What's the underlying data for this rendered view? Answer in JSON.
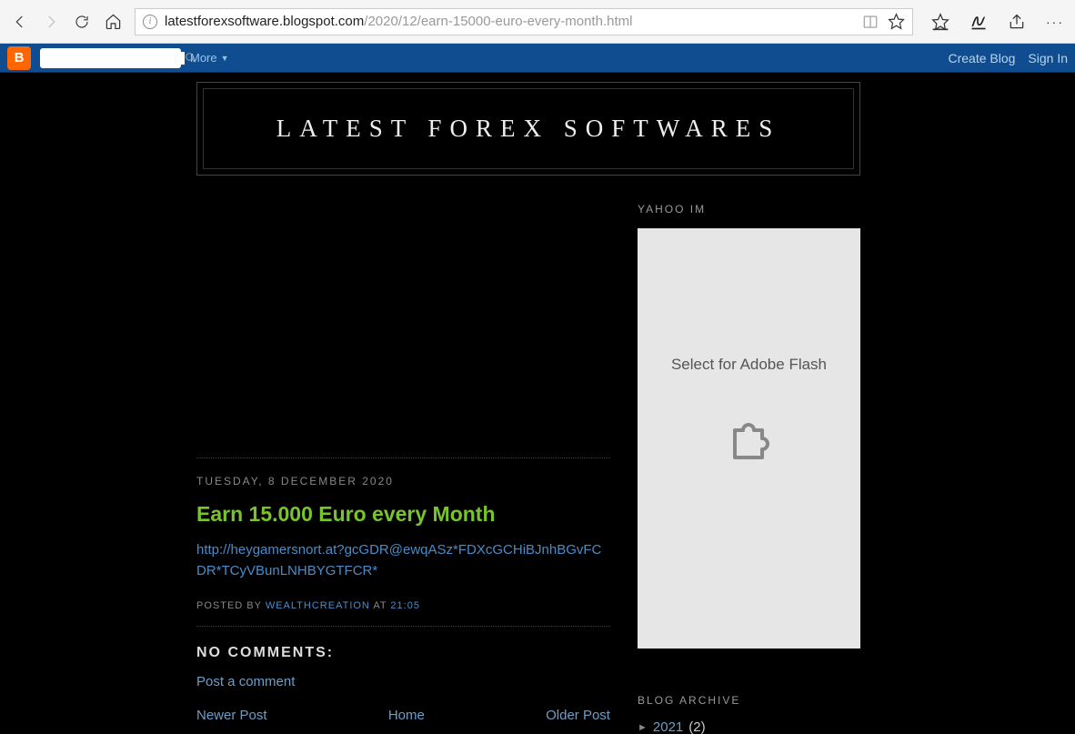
{
  "browser": {
    "url_host": "latestforexsoftware.blogspot.com",
    "url_path": "/2020/12/earn-15000-euro-every-month.html"
  },
  "blogger": {
    "logo_letter": "B",
    "more": "More",
    "create": "Create Blog",
    "signin": "Sign In"
  },
  "site": {
    "title": "LATEST FOREX SOFTWARES"
  },
  "post": {
    "date": "TUESDAY, 8 DECEMBER 2020",
    "title": "Earn 15.000 Euro every Month",
    "body": "http://heygamersnort.at?gcGDR@ewqASz*FDXcGCHiBJnhBGvFCDR*TCyVBunLNHBYGTFCR*",
    "posted_by": "POSTED BY ",
    "author": "WEALTHCREATION",
    "at": " AT ",
    "time": "21:05"
  },
  "comments": {
    "heading": "NO COMMENTS:",
    "post_link": "Post a comment"
  },
  "nav": {
    "newer": "Newer Post",
    "home": "Home",
    "older": "Older Post"
  },
  "sidebar": {
    "yahoo_hd": "YAHOO IM",
    "flash_text": "Select for Adobe Flash",
    "archive_hd": "BLOG ARCHIVE",
    "archive": {
      "year": "2021",
      "count": "(2)"
    }
  }
}
